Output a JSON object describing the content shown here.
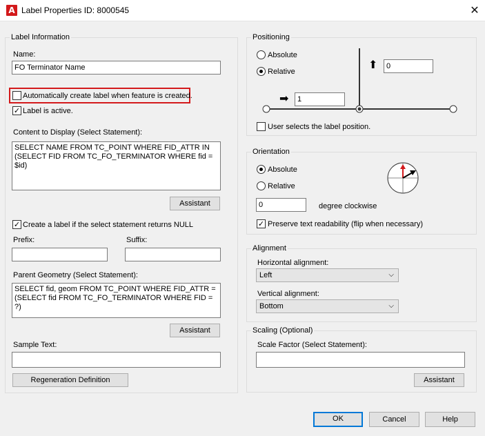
{
  "window": {
    "title": "Label Properties ID: 8000545",
    "app_icon": "autocad-a-icon",
    "close_glyph": "✕"
  },
  "label_information": {
    "legend": "Label Information",
    "name_label": "Name:",
    "name_value": "FO Terminator Name",
    "auto_create_label": "Automatically create label when feature is created.",
    "auto_create_checked": false,
    "label_active": "Label is active.",
    "label_active_checked": true,
    "content_label": "Content to Display (Select Statement):",
    "content_value": "SELECT NAME FROM TC_POINT WHERE FID_ATTR IN\n(SELECT FID FROM TC_FO_TERMINATOR WHERE fid =\n$id)",
    "assistant1": "Assistant",
    "create_if_null": "Create a label if the select statement returns NULL",
    "create_if_null_checked": true,
    "prefix_label": "Prefix:",
    "prefix_value": "",
    "suffix_label": "Suffix:",
    "suffix_value": "",
    "parent_label": "Parent Geometry (Select Statement):",
    "parent_value": "SELECT fid, geom FROM TC_POINT WHERE FID_ATTR =\n(SELECT fid FROM TC_FO_TERMINATOR WHERE FID = ?)",
    "assistant2": "Assistant",
    "sample_label": "Sample Text:",
    "sample_value": "",
    "regen_button": "Regeneration Definition"
  },
  "positioning": {
    "legend": "Positioning",
    "absolute": "Absolute",
    "relative": "Relative",
    "selected": "Relative",
    "x_offset": "1",
    "y_offset": "0",
    "user_selects": "User selects the label position.",
    "user_selects_checked": false
  },
  "orientation": {
    "legend": "Orientation",
    "absolute": "Absolute",
    "relative": "Relative",
    "selected": "Absolute",
    "degrees": "0",
    "degree_label": "degree clockwise",
    "preserve": "Preserve text readability (flip when necessary)",
    "preserve_checked": true
  },
  "alignment": {
    "legend": "Alignment",
    "horizontal_label": "Horizontal alignment:",
    "horizontal_value": "Left",
    "vertical_label": "Vertical alignment:",
    "vertical_value": "Bottom"
  },
  "scaling": {
    "legend": "Scaling (Optional)",
    "scale_label": "Scale Factor (Select Statement):",
    "scale_value": "",
    "assistant3": "Assistant"
  },
  "footer": {
    "ok": "OK",
    "cancel": "Cancel",
    "help": "Help"
  },
  "colors": {
    "accent": "#0078d7",
    "highlight": "#d3191b",
    "compass_arrow": "#d3191b"
  }
}
